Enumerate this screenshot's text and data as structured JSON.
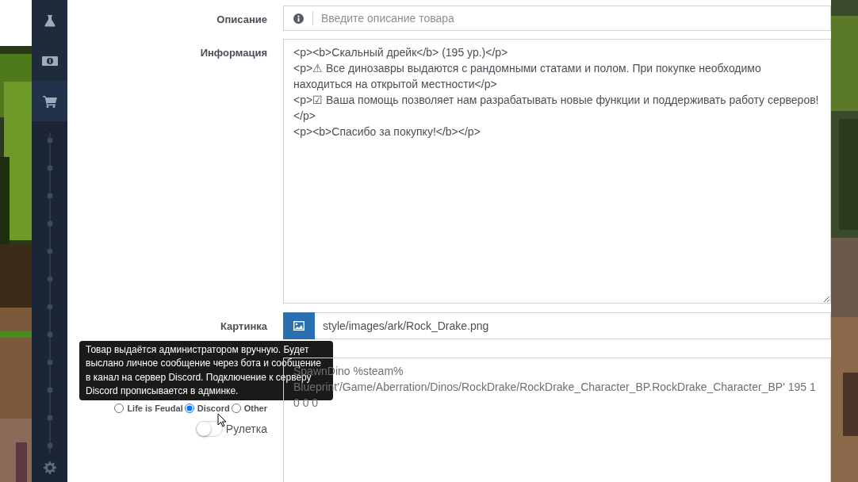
{
  "sidebar": {
    "items": [
      {
        "selected": false
      },
      {
        "selected": false
      },
      {
        "selected": true
      }
    ]
  },
  "form": {
    "description": {
      "label": "Описание",
      "placeholder": "Введите описание товара"
    },
    "info": {
      "label": "Информация",
      "value": "<p><b>Скальный дрейк</b> (195 ур.)</p>\n<p>⚠ Все динозавры выдаются с рандомными статами и полом. При покупке необходимо находиться на открытой местности</p>\n<p>☑ Ваша помощь позволяет нам разрабатывать новые функции и поддерживать работу серверов!</p>\n<p><b>Спасибо за покупку!</b></p>"
    },
    "image": {
      "label": "Картинка",
      "value": "style/images/ark/Rock_Drake.png"
    },
    "command": {
      "value": "SpawnDino %steam% Blueprint'/Game/Aberration/Dinos/RockDrake/RockDrake_Character_BP.RockDrake_Character_BP' 195 1 0 0 0"
    },
    "platforms": [
      {
        "label": "Life is Feudal",
        "selected": false
      },
      {
        "label": "Discord",
        "selected": true
      },
      {
        "label": "Other",
        "selected": false
      }
    ],
    "roulette": {
      "label": "Рулетка",
      "on": false
    }
  },
  "tooltip": {
    "text": "Товар выдаётся администратором вручную. Будет выслано личное сообщение через бота и сообщение в канал на сервер Discord. Подключение к серверу Discord прописывается в админке."
  }
}
